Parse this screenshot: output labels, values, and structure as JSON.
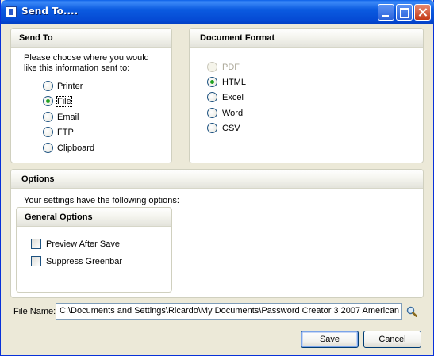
{
  "window": {
    "title": "Send To...."
  },
  "send_to": {
    "header": "Send To",
    "prompt_line1": "Please choose where you would",
    "prompt_line2": "like this information sent to:",
    "options": [
      {
        "label": "Printer",
        "selected": false
      },
      {
        "label": "File",
        "selected": true
      },
      {
        "label": "Email",
        "selected": false
      },
      {
        "label": "FTP",
        "selected": false
      },
      {
        "label": "Clipboard",
        "selected": false
      }
    ]
  },
  "document_format": {
    "header": "Document Format",
    "options": [
      {
        "label": "PDF",
        "selected": false,
        "enabled": false
      },
      {
        "label": "HTML",
        "selected": true,
        "enabled": true
      },
      {
        "label": "Excel",
        "selected": false,
        "enabled": true
      },
      {
        "label": "Word",
        "selected": false,
        "enabled": true
      },
      {
        "label": "CSV",
        "selected": false,
        "enabled": true
      }
    ]
  },
  "options": {
    "header": "Options",
    "description": "Your settings have the following options:",
    "general": {
      "header": "General Options",
      "preview_label": "Preview After Save",
      "preview_checked": false,
      "greenbar_label": "Suppress Greenbar",
      "greenbar_checked": false
    }
  },
  "file": {
    "label": "File Name:",
    "value": "C:\\Documents and Settings\\Ricardo\\My Documents\\Password Creator 3   2007 American"
  },
  "buttons": {
    "save": "Save",
    "cancel": "Cancel"
  },
  "icons": {
    "browse": "magnifier-icon",
    "app": "app-icon",
    "minimize": "minimize-icon",
    "maximize": "maximize-icon",
    "close": "close-icon"
  }
}
